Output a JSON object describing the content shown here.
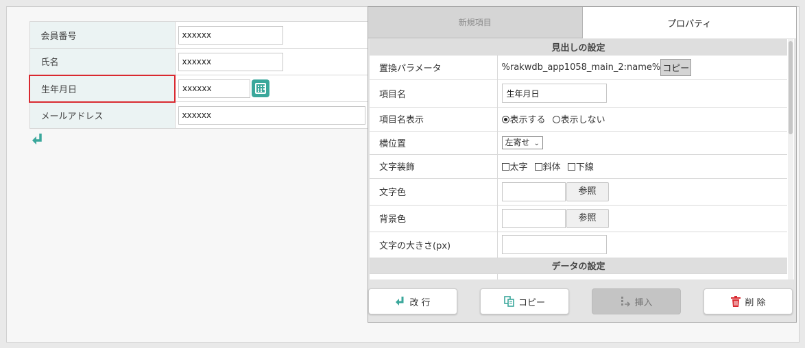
{
  "form": {
    "rows": [
      {
        "label": "会員番号",
        "value": "xxxxxx"
      },
      {
        "label": "氏名",
        "value": "xxxxxx"
      },
      {
        "label": "生年月日",
        "value": "xxxxxx"
      },
      {
        "label": "メールアドレス",
        "value": "xxxxxx"
      }
    ]
  },
  "panel": {
    "tabs": {
      "new_item": "新規項目",
      "property": "プロパティ"
    },
    "section_heading": "見出しの設定",
    "section_data": "データの設定",
    "props": {
      "param_label": "置換パラメータ",
      "param_value": "%rakwdb_app1058_main_2:name%",
      "param_copy": "コピー",
      "name_label": "項目名",
      "name_value": "生年月日",
      "display_label": "項目名表示",
      "display_show": "表示する",
      "display_hide": "表示しない",
      "align_label": "横位置",
      "align_value": "左寄せ",
      "decoration_label": "文字装飾",
      "deco_bold": "太字",
      "deco_italic": "斜体",
      "deco_underline": "下線",
      "color_label": "文字色",
      "color_ref": "参照",
      "bg_label": "背景色",
      "bg_ref": "参照",
      "size_label": "文字の大きさ(px)"
    },
    "buttons": {
      "newline": "改 行",
      "copy": "コピー",
      "insert": "挿入",
      "delete": "削 除"
    }
  },
  "colors": {
    "accent": "#3aa79b",
    "selected_border": "#d9282f",
    "delete": "#d9282f"
  }
}
